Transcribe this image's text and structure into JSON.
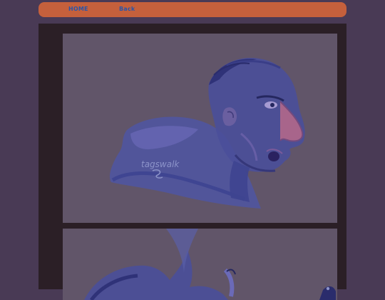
{
  "nav": {
    "home_label": "HOME",
    "back_label": "Back"
  },
  "comic": {
    "panel_1": {
      "signature": "tagswalk"
    }
  },
  "colors": {
    "background": "#493a55",
    "nav_bar": "#c5603c",
    "nav_link": "#2b55a8",
    "frame": "#2b1f26",
    "panel": "#615569"
  }
}
